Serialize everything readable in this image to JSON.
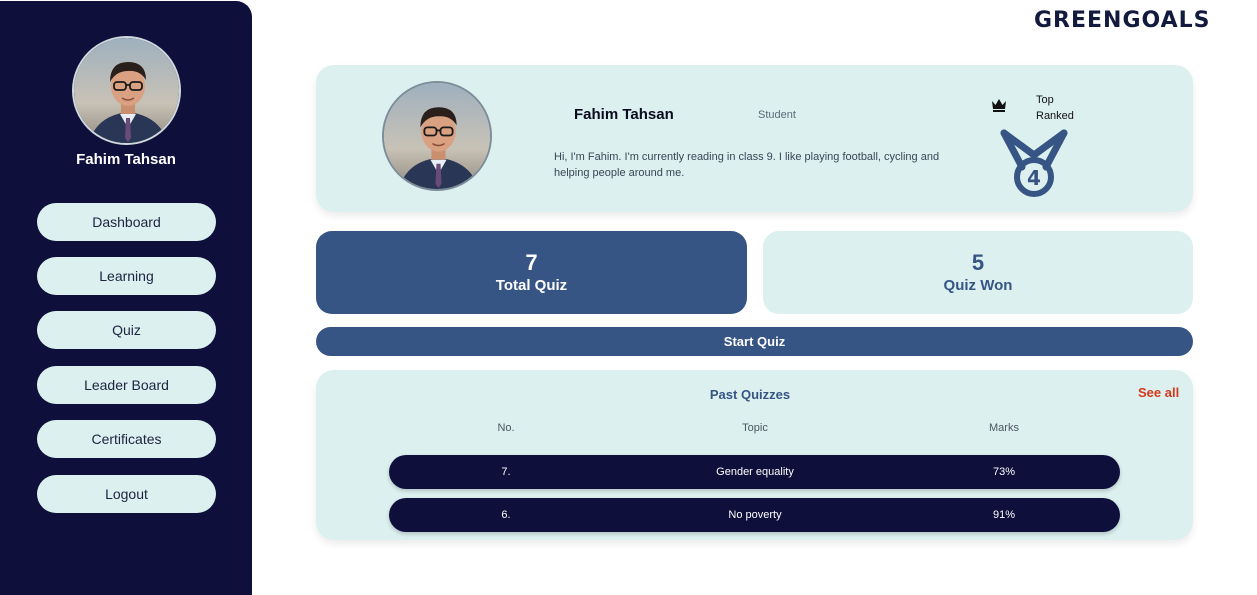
{
  "brand": {
    "logo_text": "GREENGOALS"
  },
  "user": {
    "name": "Fahim Tahsan",
    "role": "Student",
    "bio": "Hi, I'm Fahim. I'm currently reading in class 9. I like playing football, cycling and helping people around me.",
    "rank_label_line1": "Top",
    "rank_label_line2": "Ranked",
    "rank_number": "4"
  },
  "sidebar": {
    "items": [
      {
        "label": "Dashboard"
      },
      {
        "label": "Learning"
      },
      {
        "label": "Quiz"
      },
      {
        "label": "Leader Board"
      },
      {
        "label": "Certificates"
      },
      {
        "label": "Logout"
      }
    ]
  },
  "stats": {
    "total_quiz": {
      "value": "7",
      "label": "Total Quiz"
    },
    "quiz_won": {
      "value": "5",
      "label": "Quiz Won"
    }
  },
  "start_quiz_label": "Start Quiz",
  "past_quizzes": {
    "title": "Past Quizzes",
    "see_all": "See all",
    "columns": [
      "No.",
      "Topic",
      "Marks"
    ],
    "rows": [
      {
        "no": "7.",
        "topic": "Gender equality",
        "marks": "73%"
      },
      {
        "no": "6.",
        "topic": "No poverty",
        "marks": "91%"
      }
    ]
  },
  "colors": {
    "sidebar_bg": "#0e0f3b",
    "card_bg": "#dcf0ef",
    "primary": "#365584",
    "accent_link": "#d6391a"
  },
  "icons": [
    "crown-icon",
    "medal-icon",
    "avatar"
  ]
}
